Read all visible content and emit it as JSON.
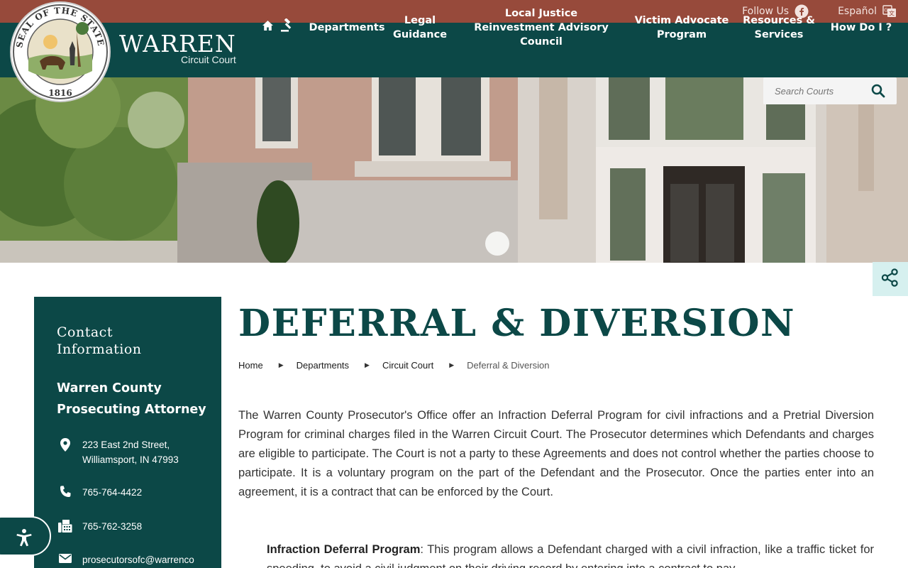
{
  "topbar": {
    "follow_label": "Follow Us",
    "language_label": "Español"
  },
  "header": {
    "seal_text": "SEAL OF THE STATE OF INDIANA",
    "seal_year": "1816",
    "brand_name": "WARREN",
    "brand_sub": "Circuit Court",
    "nav": [
      "Departments",
      "Legal Guidance",
      "Local Justice Reinvestment Advisory Council",
      "Victim Advocate Program",
      "Resources & Services",
      "How Do I ?"
    ]
  },
  "search": {
    "placeholder": "Search Courts"
  },
  "sidebar": {
    "heading": "Contact Information",
    "org": "Warren County Prosecuting Attorney",
    "address_line1": "223 East 2nd Street,",
    "address_line2": "Williamsport, IN 47993",
    "phone": "765-764-4422",
    "fax": "765-762-3258",
    "email": "prosecutorsofc@warrenco"
  },
  "page": {
    "title": "DEFERRAL & DIVERSION",
    "breadcrumb": [
      "Home",
      "Departments",
      "Circuit Court",
      "Deferral & Diversion"
    ],
    "paragraph1": "The Warren County Prosecutor's Office offer an Infraction Deferral Program for civil infractions and a Pretrial Diversion Program for criminal charges filed in the Warren Circuit Court.  The Prosecutor determines which Defendants and charges are eligible to participate.  The Court is not a party to these Agreements and does not control whether the parties choose to participate.  It is a voluntary program on the part of the Defendant and the Prosecutor.  Once the parties enter into an agreement, it is a contract that can be enforced by the Court.",
    "program_label": "Infraction Deferral Program",
    "program_text": ":  This program allows a Defendant charged with a civil infraction, like a traffic ticket for speeding, to avoid a civil judgment on their driving record by entering into a contract to pay"
  },
  "colors": {
    "brand_teal": "#0c4847",
    "topbar_brick": "#974a3b",
    "share_bg": "#d6f0ef"
  }
}
